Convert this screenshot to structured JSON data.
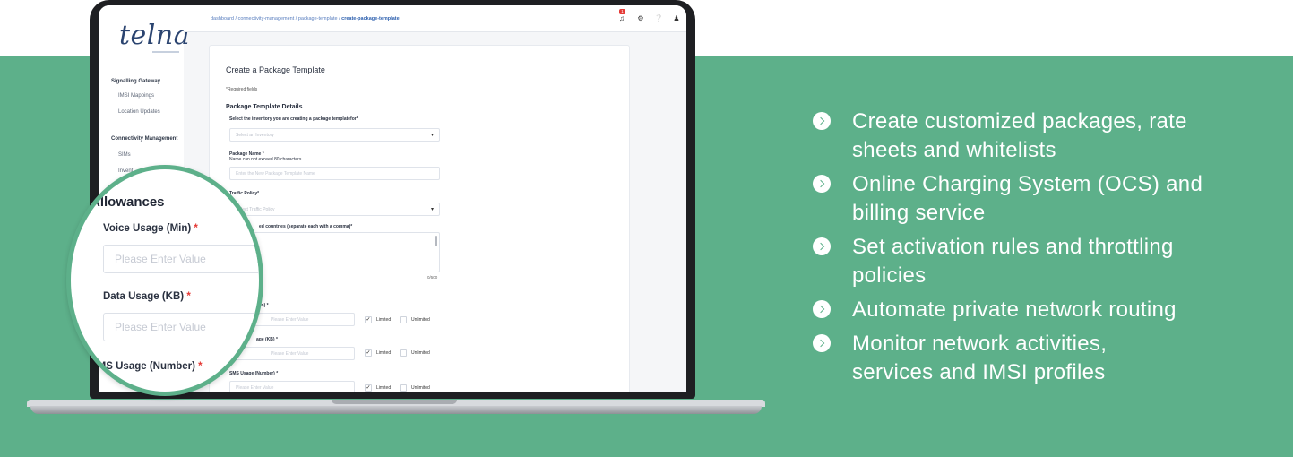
{
  "app": {
    "logo_text": "telna",
    "breadcrumb": {
      "path": "dashboard / connectivity-management  / package-template / ",
      "current": "create-package-template"
    },
    "notification_count": "1",
    "sidebar": {
      "items": [
        {
          "label": "Signalling Gateway",
          "type": "head"
        },
        {
          "label": "IMSI Mappings",
          "type": "sub"
        },
        {
          "label": "Location Updates",
          "type": "sub"
        },
        {
          "label": "Connectivity Management",
          "type": "head"
        },
        {
          "label": "SIMs",
          "type": "sub"
        },
        {
          "label": "Invent",
          "type": "sub"
        }
      ]
    }
  },
  "form": {
    "title": "Create a Package Template",
    "required_note": "*Required fields",
    "section": "Package Template Details",
    "inventory_label": "Select the inventory you are creating a package templatefor*",
    "inventory_placeholder": "Select an Inventory",
    "package_name_label": "Package Name *",
    "package_name_hint": "Name can not exceed 80 characters.",
    "package_name_placeholder": "Enter the New Package Template Name",
    "traffic_label": "Traffic Policy*",
    "traffic_placeholder": "Select Traffic Policy",
    "countries_label": "ed countries (separate each with a comma)*",
    "counter": "0/500",
    "voice_label": "Min) *",
    "data_label": "age (KB) *",
    "sms_label": "SMS Usage (Number) *",
    "value_placeholder": "Please Enter Value",
    "limited": "Limited",
    "unlimited": "Unlimited"
  },
  "magnifier": {
    "title": "Allowances",
    "voice_label": "Voice Usage (Min)",
    "data_label": "Data Usage (KB)",
    "sms_label": "SMS Usage (Number)",
    "required_mark": "*",
    "placeholder": "Please Enter Value"
  },
  "features": [
    {
      "line1": "Create customized packages, rate",
      "line2": "sheets and whitelists"
    },
    {
      "line1": "Online Charging System (OCS) and",
      "line2": "billing service"
    },
    {
      "line1": "Set activation rules and throttling",
      "line2": "policies"
    },
    {
      "line1": "Automate private network routing",
      "line2": ""
    },
    {
      "line1": "Monitor network activities,",
      "line2": "services and IMSI profiles"
    }
  ],
  "colors": {
    "band": "#5db08a",
    "text_on_band": "#ffffff",
    "required_star": "#e53935"
  }
}
